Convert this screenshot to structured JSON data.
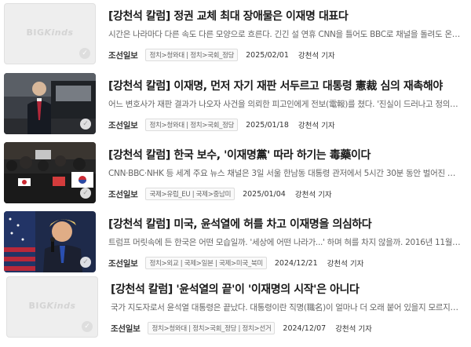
{
  "placeholder_logo": {
    "big": "BIG",
    "kinds": "Kinds"
  },
  "articles": [
    {
      "title": "[강천석 칼럼] 정권 교체 최대 장애물은 이재명 대표다",
      "summary": "시간은 나라마다 다른 속도 다른 모양으로 흐른다. 긴긴 설 연휴 CNN을 틀어도 BBC로 채널을 돌려도 온통 양원평이라...",
      "press": "조선일보",
      "category": "정치>청와대 | 정치>국회_정당",
      "date": "2025/02/01",
      "author": "강천석 기자",
      "thumbnail": "placeholder"
    },
    {
      "title": "[강천석 칼럼] 이재명, 먼저 자기 재판 서두르고 대통령 憲裁 심의 재촉해야",
      "summary": "어느 변호사가 재판 결과가 나오자 사건을 의뢰한 피고인에게 전보(電報)를 쳤다. '진실이 드러나고 정의가 실현됐습니...",
      "press": "조선일보",
      "category": "정치>청와대 | 정치>국회_정당",
      "date": "2025/01/18",
      "author": "강천석 기자",
      "thumbnail": "photo-man-car"
    },
    {
      "title": "[강천석 칼럼] 한국 보수, '이재명黨' 따라 하기는 毒藥이다",
      "summary": "CNN·BBC·NHK 등 세계 주요 뉴스 채널은 3일 서울 한남동 대통령 관저에서 5시간 30분 동안 벌어진 현직 대통령 체포 ...",
      "press": "조선일보",
      "category": "국제>유럽_EU | 국제>중남미",
      "date": "2025/01/04",
      "author": "강천석 기자",
      "thumbnail": "photo-rally"
    },
    {
      "title": "[강천석 칼럼] 미국, 윤석열에 허를 차고 이재명을 의심하다",
      "summary": "트럼프 머릿속에 든 한국은 어떤 모습일까. '세상에 어떤 나라가...' 하며 혀를 차지 않을까. 2016년 11월 5일 대통령에 당...",
      "press": "조선일보",
      "category": "정치>외교 | 국제>일본 | 국제>미국_북미",
      "date": "2024/12/21",
      "author": "강천석 기자",
      "thumbnail": "photo-trump"
    },
    {
      "title": "[강천석 칼럼] '윤석열의 끝'이 '이재명의 시작'은 아니다",
      "summary": "국가 지도자로서 윤석열 대통령은 끝났다. 대통령이란 직명(職名)이 얼마나 더 오래 붙어 있을지 모르지만 국가 지도자 ...",
      "press": "조선일보",
      "category": "정치>청와대 | 정치>국회_정당 | 정치>선거",
      "date": "2024/12/07",
      "author": "강천석 기자",
      "thumbnail": "placeholder"
    }
  ]
}
